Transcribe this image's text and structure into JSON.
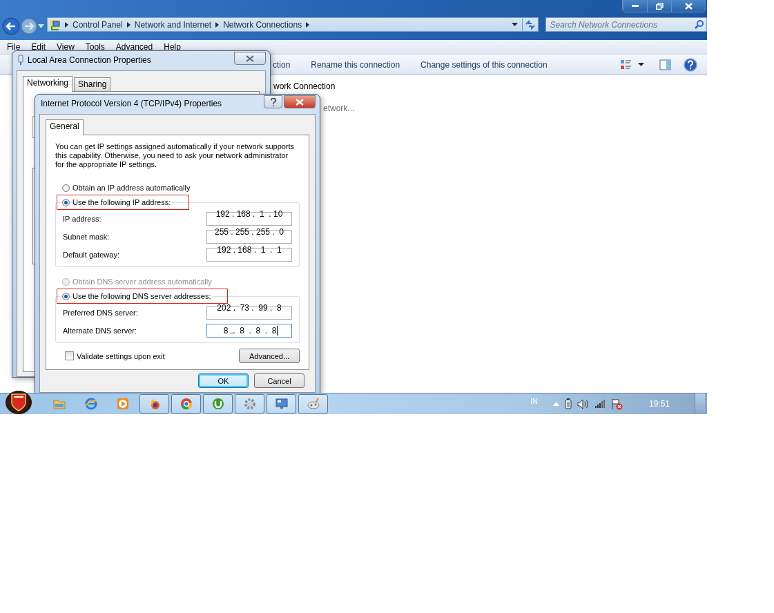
{
  "explorer": {
    "breadcrumb": [
      "Control Panel",
      "Network and Internet",
      "Network Connections"
    ],
    "search": {
      "placeholder": "Search Network Connections"
    },
    "menu": [
      "File",
      "Edit",
      "View",
      "Tools",
      "Advanced",
      "Help"
    ],
    "toolbar": [
      "ction",
      "Rename this connection",
      "Change settings of this connection"
    ],
    "items": [
      {
        "text": "work Connection",
        "kind": "name"
      },
      {
        "text": "etwork...",
        "kind": "status"
      }
    ]
  },
  "lan_dialog": {
    "title": "Local Area Connection Properties",
    "tabs": [
      {
        "label": "Networking",
        "selected": true
      },
      {
        "label": "Sharing",
        "selected": false
      }
    ]
  },
  "ipv4_dialog": {
    "title": "Internet Protocol Version 4 (TCP/IPv4) Properties",
    "tabs": [
      {
        "label": "General",
        "selected": true
      }
    ],
    "intro": "You can get IP settings assigned automatically if your network supports this capability. Otherwise, you need to ask your network administrator for the appropriate IP settings.",
    "ip_options": [
      {
        "label": "Obtain an IP address automatically",
        "selected": false,
        "disabled": false,
        "annotated": false
      },
      {
        "label": "Use the following IP address:",
        "selected": true,
        "disabled": false,
        "annotated": true
      }
    ],
    "ip_fields": [
      {
        "label": "IP address:",
        "value": "192 . 168 .  1  . 10",
        "focused": false,
        "annotated": false
      },
      {
        "label": "Subnet mask:",
        "value": "255 . 255 . 255 .  0",
        "focused": false,
        "annotated": false
      },
      {
        "label": "Default gateway:",
        "value": "192 . 168 .  1  .  1",
        "focused": false,
        "annotated": false
      }
    ],
    "dns_options": [
      {
        "label": "Obtain DNS server address automatically",
        "selected": false,
        "disabled": true,
        "annotated": false
      },
      {
        "label": "Use the following DNS server addresses:",
        "selected": true,
        "disabled": false,
        "annotated": true
      }
    ],
    "dns_fields": [
      {
        "label": "Preferred DNS server:",
        "value": "202 .  73 .  99 .  8",
        "focused": false,
        "annotated": false
      },
      {
        "label": "Alternate DNS server:",
        "value": " 8  .  8  .  8  .  8",
        "focused": true,
        "annotated": true
      }
    ],
    "validate": {
      "label": "Validate settings upon exit",
      "checked": false
    },
    "advanced": "Advanced...",
    "buttons": [
      {
        "label": "OK",
        "default": true
      },
      {
        "label": "Cancel",
        "default": false
      }
    ]
  },
  "taskbar": {
    "apps": [
      {
        "running": false
      },
      {
        "running": false
      },
      {
        "running": false
      },
      {
        "running": true
      },
      {
        "running": true
      },
      {
        "running": true
      },
      {
        "running": true
      },
      {
        "running": true
      },
      {
        "running": true
      }
    ],
    "language": "IN",
    "time": "19:51"
  }
}
